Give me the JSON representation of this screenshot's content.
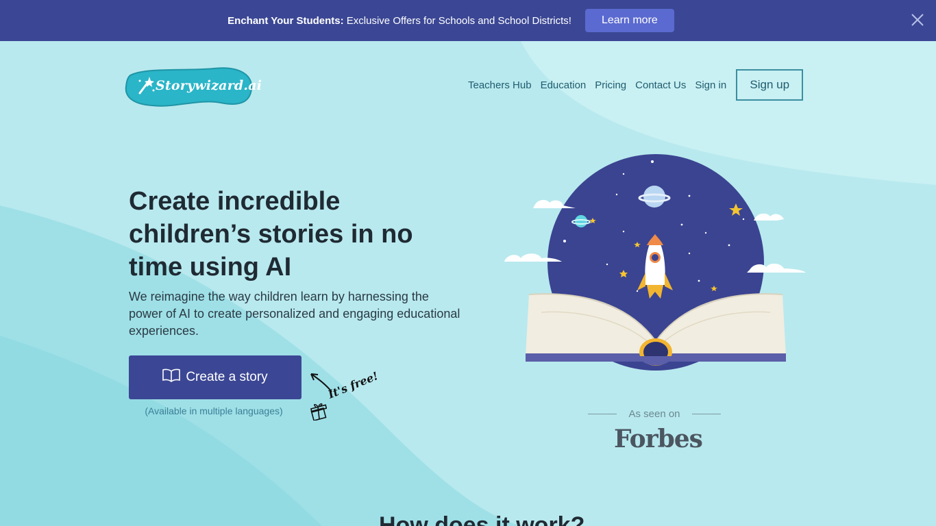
{
  "banner": {
    "bold_text": "Enchant Your Students:",
    "text": " Exclusive Offers for Schools and School Districts!",
    "button_label": "Learn more",
    "close_icon": "close-icon"
  },
  "logo": {
    "text": "Storywizard.ai",
    "icon": "magic-wand-icon"
  },
  "nav": {
    "items": [
      "Teachers Hub",
      "Education",
      "Pricing",
      "Contact Us",
      "Sign in"
    ],
    "signup_label": "Sign up"
  },
  "hero": {
    "title": "Create incredible children’s stories in no time using AI",
    "subtitle": "We reimagine the way children learn by harnessing the power of AI to create personalized and engaging educational experiences.",
    "cta_label": "Create a story",
    "cta_icon": "book-icon",
    "cta_note": "(Available in multiple languages)",
    "free_note": "It's free!",
    "free_icon": "gift-icon"
  },
  "press": {
    "label": "As seen on",
    "brand": "Forbes"
  },
  "section": {
    "how_title": "How does it work?"
  },
  "colors": {
    "banner_bg": "#3b4794",
    "banner_button": "#5b6ad0",
    "page_bg": "#b8e9ee",
    "primary": "#3b4794",
    "logo_teal": "#2ab5c8"
  }
}
